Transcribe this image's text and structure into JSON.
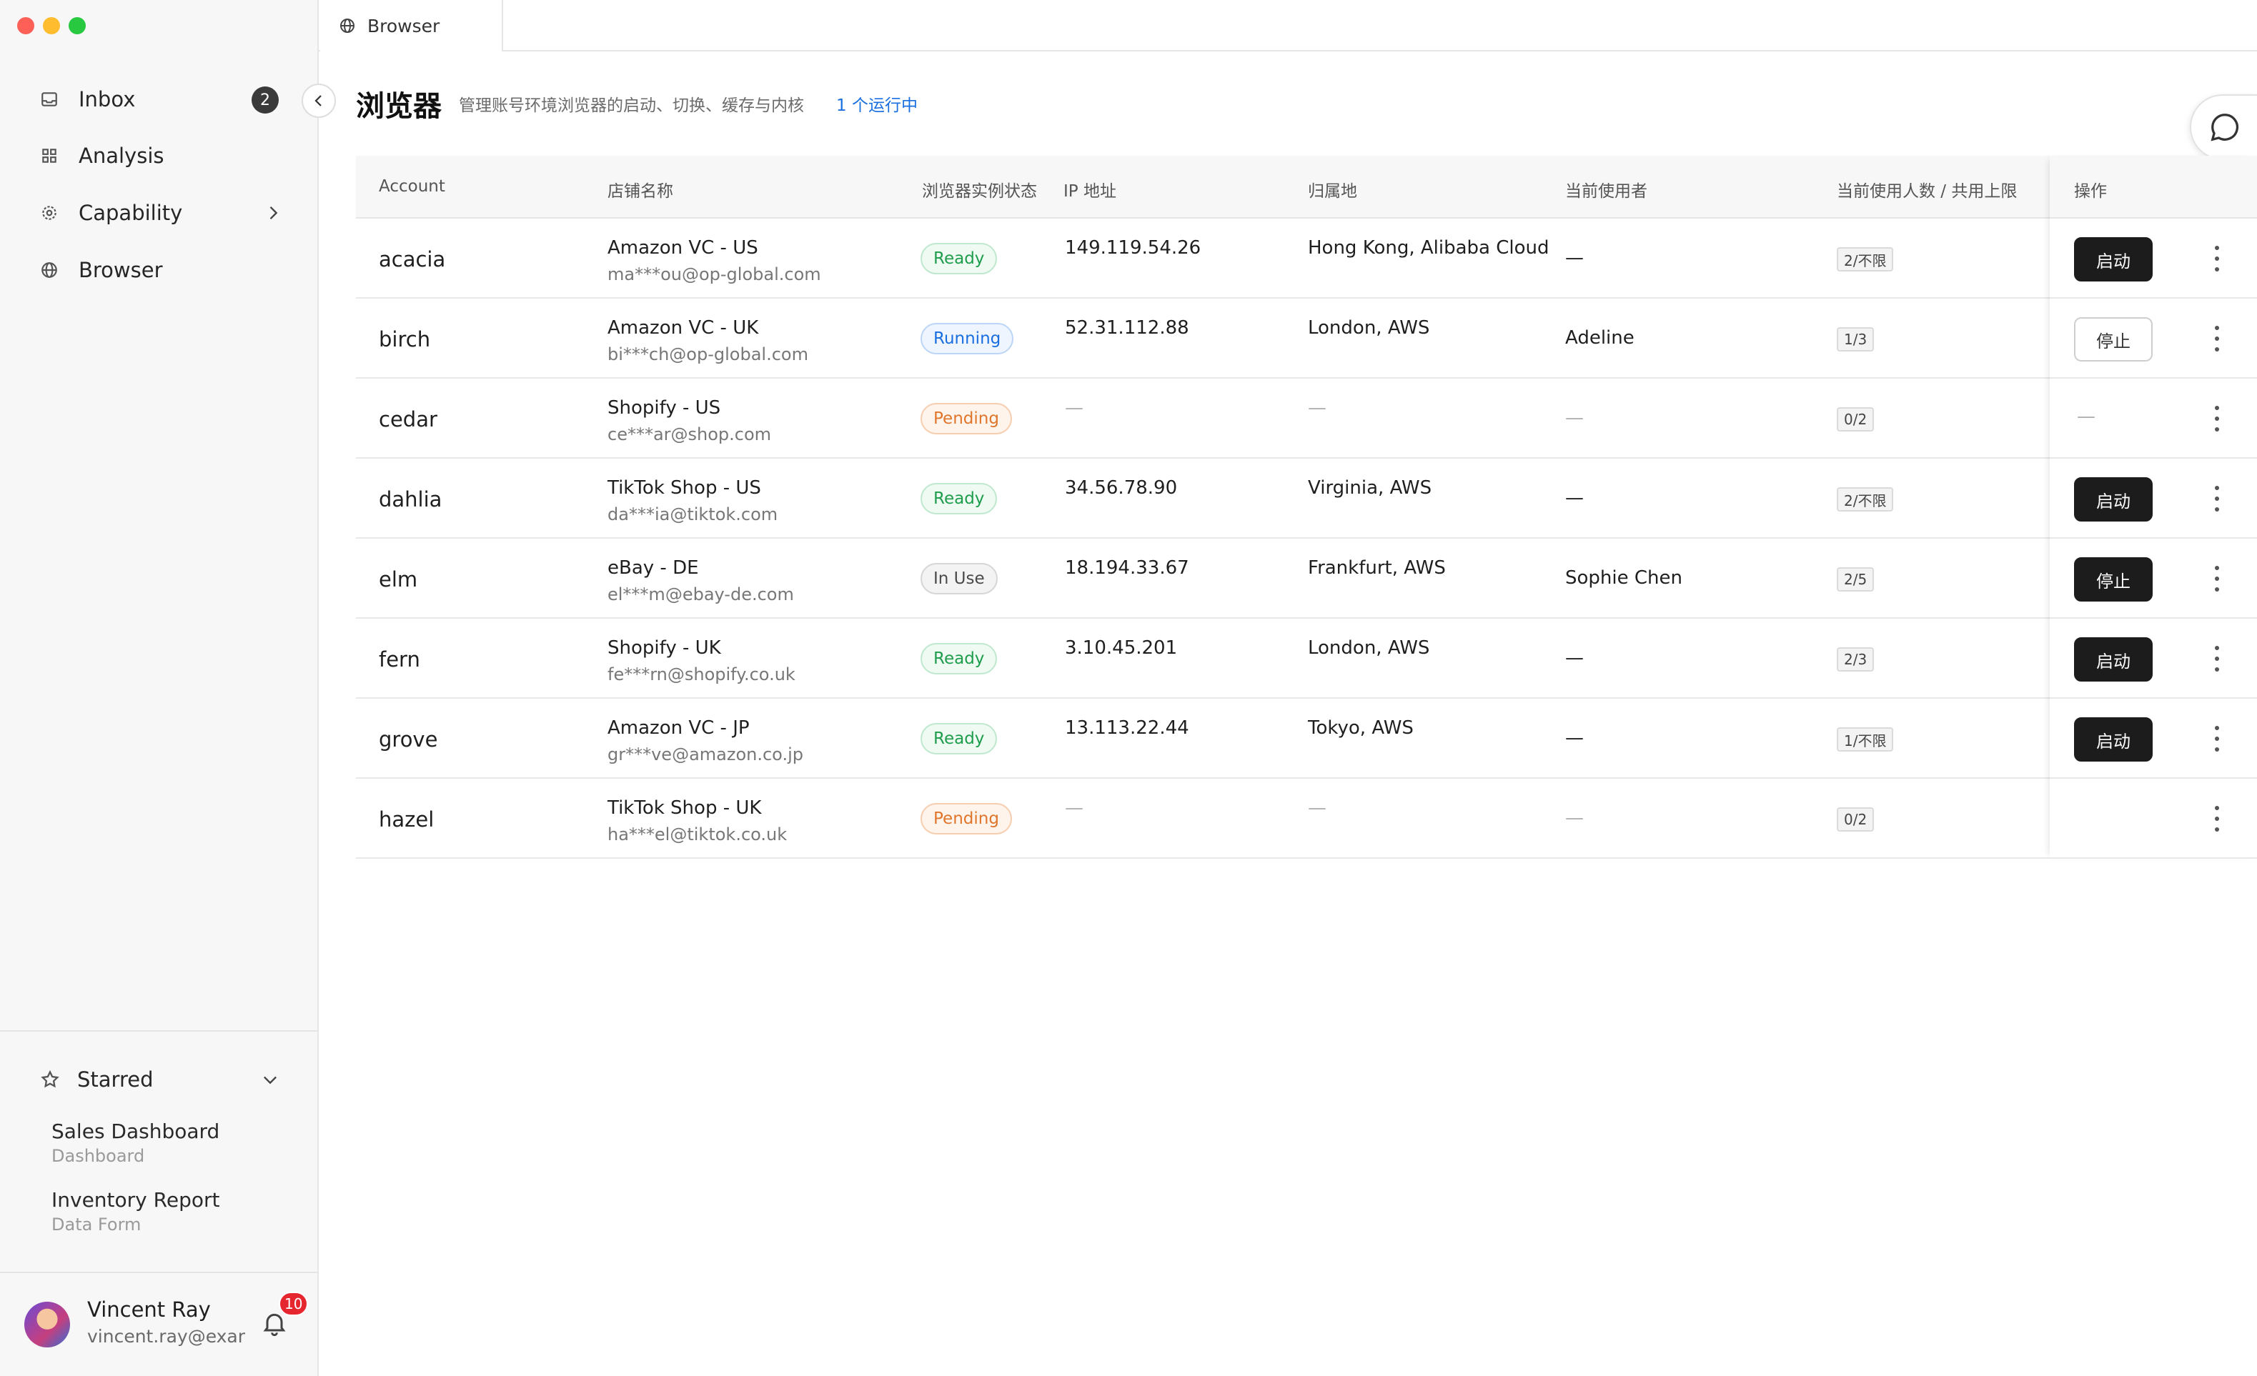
{
  "tab": {
    "label": "Browser",
    "icon": "globe-icon"
  },
  "sidebar": {
    "items": [
      {
        "label": "Inbox",
        "icon": "inbox-icon",
        "badge": "2"
      },
      {
        "label": "Analysis",
        "icon": "grid-icon"
      },
      {
        "label": "Capability",
        "icon": "gear-icon"
      },
      {
        "label": "Browser",
        "icon": "globe-icon"
      }
    ],
    "starred": {
      "label": "Starred",
      "items": [
        {
          "title": "Sales Dashboard",
          "subtitle": "Dashboard"
        },
        {
          "title": "Inventory Report",
          "subtitle": "Data Form"
        }
      ]
    },
    "user": {
      "name": "Vincent Ray",
      "email": "vincent.ray@exar",
      "notifications": "10"
    }
  },
  "page": {
    "title": "浏览器",
    "description": "管理账号环境浏览器的启动、切换、缓存与内核",
    "running": "1 个运行中"
  },
  "table": {
    "headers": {
      "account": "Account",
      "store": "店铺名称",
      "status": "浏览器实例状态",
      "ip": "IP 地址",
      "location": "归属地",
      "user": "当前使用者",
      "limit": "当前使用人数 / 共用上限",
      "actions": "操作"
    },
    "rows": [
      {
        "account": "acacia",
        "store": "Amazon VC - US",
        "email": "ma***ou@op-global.com",
        "status": "Ready",
        "ip": "149.119.54.26",
        "location": "Hong Kong, Alibaba Cloud",
        "user": "—",
        "limit": "2/不限",
        "action": "启动"
      },
      {
        "account": "birch",
        "store": "Amazon VC - UK",
        "email": "bi***ch@op-global.com",
        "status": "Running",
        "ip": "52.31.112.88",
        "location": "London, AWS",
        "user": "Adeline",
        "limit": "1/3",
        "action": "停止"
      },
      {
        "account": "cedar",
        "store": "Shopify - US",
        "email": "ce***ar@shop.com",
        "status": "Pending",
        "ip": "—",
        "location": "—",
        "user": "—",
        "limit": "0/2",
        "action": "—"
      },
      {
        "account": "dahlia",
        "store": "TikTok Shop - US",
        "email": "da***ia@tiktok.com",
        "status": "Ready",
        "ip": "34.56.78.90",
        "location": "Virginia, AWS",
        "user": "—",
        "limit": "2/不限",
        "action": "启动"
      },
      {
        "account": "elm",
        "store": "eBay - DE",
        "email": "el***m@ebay-de.com",
        "status": "In Use",
        "ip": "18.194.33.67",
        "location": "Frankfurt, AWS",
        "user": "Sophie Chen",
        "limit": "2/5",
        "action": "停止"
      },
      {
        "account": "fern",
        "store": "Shopify - UK",
        "email": "fe***rn@shopify.co.uk",
        "status": "Ready",
        "ip": "3.10.45.201",
        "location": "London, AWS",
        "user": "—",
        "limit": "2/3",
        "action": "启动"
      },
      {
        "account": "grove",
        "store": "Amazon VC - JP",
        "email": "gr***ve@amazon.co.jp",
        "status": "Ready",
        "ip": "13.113.22.44",
        "location": "Tokyo, AWS",
        "user": "—",
        "limit": "1/不限",
        "action": "启动"
      },
      {
        "account": "hazel",
        "store": "TikTok Shop - UK",
        "email": "ha***el@tiktok.co.uk",
        "status": "Pending",
        "ip": "—",
        "location": "—",
        "user": "—",
        "limit": "0/2",
        "action": ""
      }
    ]
  },
  "colors": {
    "accent_link": "#1a6fe0",
    "status_ready": "#1f9d4c",
    "status_running": "#1a6fe0",
    "status_pending": "#e0762b",
    "status_inuse": "#4a4a4a",
    "primary_button": "#1c1c1c",
    "notification_badge": "#e5262e"
  }
}
